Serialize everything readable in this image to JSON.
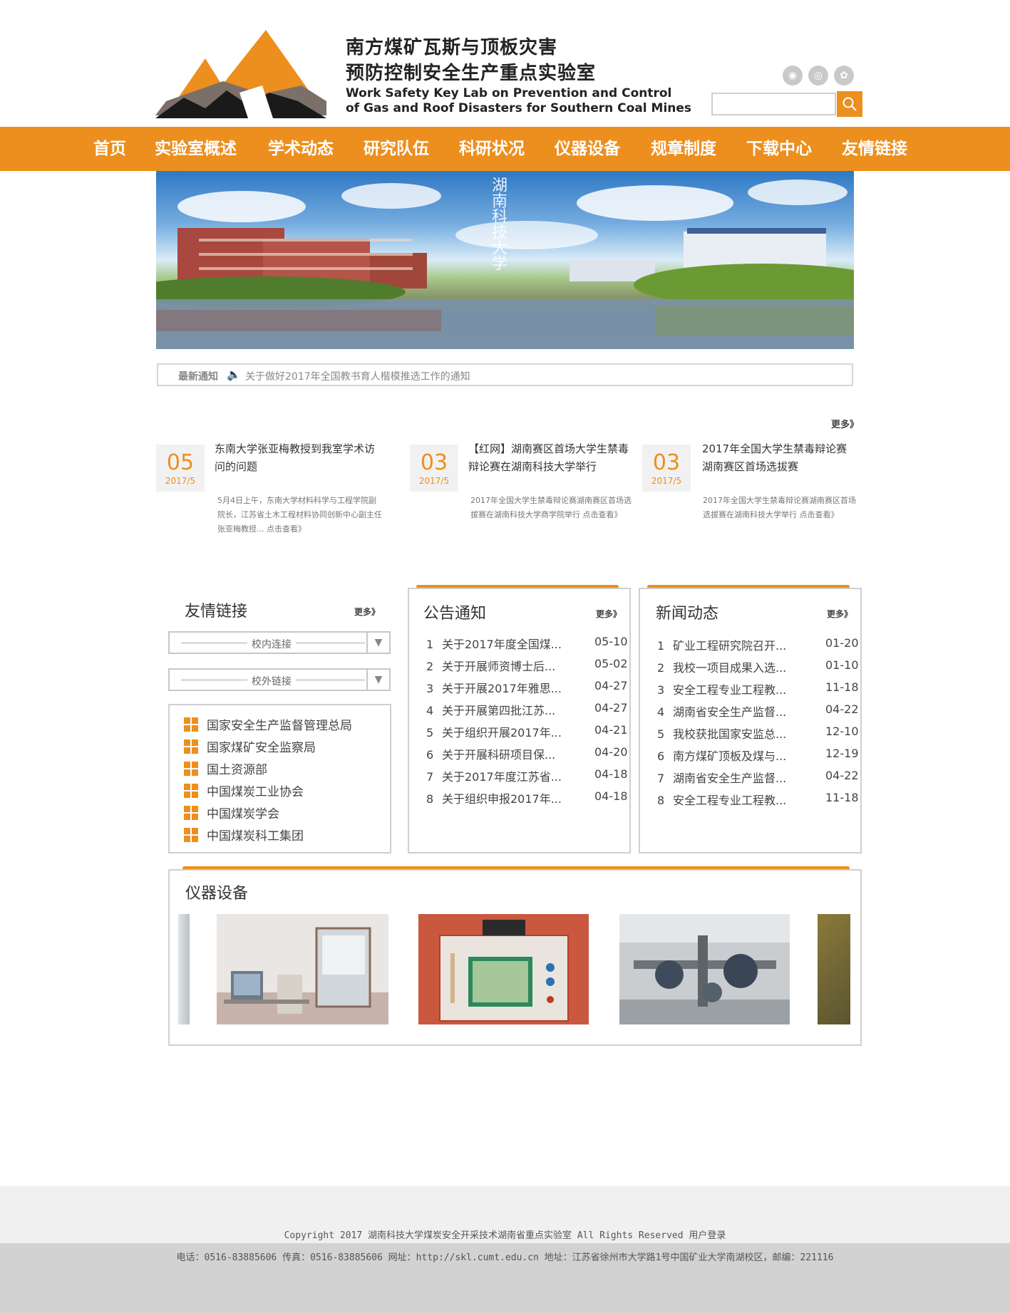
{
  "header": {
    "title_cn_line1": "南方煤矿瓦斯与顶板灾害",
    "title_cn_line2": "预防控制安全生产重点实验室",
    "title_en_line1": "Work Safety Key Lab on Prevention and Control",
    "title_en_line2": "of Gas and Roof Disasters for Southern Coal Mines",
    "social_icons": [
      "weibo-icon",
      "tencent-weibo-icon",
      "renren-icon"
    ],
    "search_placeholder": "",
    "search_icon": "search-icon",
    "accent_color": "#ec8f1e"
  },
  "nav": {
    "items": [
      "首页",
      "实验室概述",
      "学术动态",
      "研究队伍",
      "科研状况",
      "仪器设备",
      "规章制度",
      "下载中心",
      "友情链接"
    ]
  },
  "banner": {
    "calligraphy": "湖南科技大学"
  },
  "ticker": {
    "label": "最新通知",
    "icon": "speaker-icon",
    "text": "关于做好2017年全国教书育人楷模推选工作的通知"
  },
  "featured": {
    "more_label": "更多》",
    "items": [
      {
        "day": "05",
        "ym": "2017/5",
        "title": "东南大学张亚梅教授到我室学术访问的问题",
        "summary": "5月4日上午，东南大学材料科学与工程学院副院长，江苏省土木工程材料协同创新中心副主任张亚梅教授... 点击查看》"
      },
      {
        "day": "03",
        "ym": "2017/5",
        "title": "【红网】湖南赛区首场大学生禁毒辩论赛在湖南科技大学举行",
        "summary": "2017年全国大学生禁毒辩论赛湖南赛区首场选拔赛在湖南科技大学商学院举行 点击查看》"
      },
      {
        "day": "03",
        "ym": "2017/5",
        "title": "2017年全国大学生禁毒辩论赛湖南赛区首场选拔赛",
        "summary": "2017年全国大学生禁毒辩论赛湖南赛区首场选拔赛在湖南科技大学举行 点击查看》"
      }
    ]
  },
  "links_panel": {
    "title": "友情链接",
    "more_label": "更多》",
    "select_internal": "校内连接",
    "select_external": "校外链接",
    "items": [
      "国家安全生产监督管理总局",
      "国家煤矿安全监察局",
      "国土资源部",
      "中国煤炭工业协会",
      "中国煤炭学会",
      "中国煤炭科工集团"
    ]
  },
  "notice_panel": {
    "title": "公告通知",
    "more_label": "更多》",
    "items": [
      {
        "num": "1",
        "title": "关于2017年度全国煤...",
        "date": "05-10"
      },
      {
        "num": "2",
        "title": "关于开展师资博士后...",
        "date": "05-02"
      },
      {
        "num": "3",
        "title": "关于开展2017年雅思...",
        "date": "04-27"
      },
      {
        "num": "4",
        "title": "关于开展第四批江苏...",
        "date": "04-27"
      },
      {
        "num": "5",
        "title": "关于组织开展2017年...",
        "date": "04-21"
      },
      {
        "num": "6",
        "title": "关于开展科研项目保...",
        "date": "04-20"
      },
      {
        "num": "7",
        "title": "关于2017年度江苏省...",
        "date": "04-18"
      },
      {
        "num": "8",
        "title": "关于组织申报2017年...",
        "date": "04-18"
      }
    ]
  },
  "news_panel": {
    "title": "新闻动态",
    "more_label": "更多》",
    "items": [
      {
        "num": "1",
        "title": "矿业工程研究院召开...",
        "date": "01-20"
      },
      {
        "num": "2",
        "title": "我校一项目成果入选...",
        "date": "01-10"
      },
      {
        "num": "3",
        "title": "安全工程专业工程教...",
        "date": "11-18"
      },
      {
        "num": "4",
        "title": "湖南省安全生产监督...",
        "date": "04-22"
      },
      {
        "num": "5",
        "title": "我校获批国家安监总...",
        "date": "12-10"
      },
      {
        "num": "6",
        "title": "南方煤矿顶板及煤与...",
        "date": "12-19"
      },
      {
        "num": "7",
        "title": "湖南省安全生产监督...",
        "date": "04-22"
      },
      {
        "num": "8",
        "title": "安全工程专业工程教...",
        "date": "11-18"
      }
    ]
  },
  "equipment": {
    "title": "仪器设备"
  },
  "footer": {
    "copyright": "Copyright 2017 湖南科技大学煤炭安全开采技术湖南省重点实验室 All Rights Reserved 用户登录",
    "contact": "电话：0516-83885606 传真：0516-83885606 网址：http://skl.cumt.edu.cn 地址：江苏省徐州市大学路1号中国矿业大学南湖校区，邮编：221116"
  }
}
